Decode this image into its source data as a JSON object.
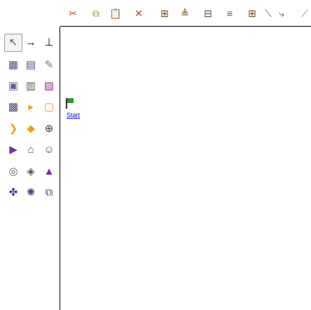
{
  "toolbar": {
    "items": [
      {
        "name": "cut-icon",
        "glyph": "✂",
        "color": "#c24a18"
      },
      {
        "name": "copy-icon",
        "glyph": "⧉",
        "color": "#b08a40"
      },
      {
        "name": "paste-icon",
        "glyph": "📋",
        "color": "#b08a40"
      },
      {
        "name": "delete-icon",
        "glyph": "✕",
        "color": "#c0392b"
      },
      {
        "name": "align-top-icon",
        "glyph": "⊞",
        "color": "#6b4a1a"
      },
      {
        "name": "align-middle-icon",
        "glyph": "≜",
        "color": "#6b4a1a"
      },
      {
        "name": "align-center-icon",
        "glyph": "⊟",
        "color": "#6b4a1a"
      },
      {
        "name": "align-bottom-icon",
        "glyph": "≡",
        "color": "#6b4a1a"
      },
      {
        "name": "distribute-icon",
        "glyph": "⊞",
        "color": "#6b4a1a"
      },
      {
        "name": "straight-line-icon",
        "glyph": "⟍",
        "color": "#2a5aa8"
      },
      {
        "name": "elbow-line-icon",
        "glyph": "⤷",
        "color": "#2a5aa8"
      },
      {
        "name": "curve-line-icon",
        "glyph": "⟋",
        "color": "#3a8fd8"
      }
    ]
  },
  "palette": {
    "items": [
      {
        "name": "pointer-tool-icon",
        "glyph": "↖",
        "color": "#5a5a5a"
      },
      {
        "name": "transition-arrow-icon",
        "glyph": "→",
        "color": "#000000"
      },
      {
        "name": "end-bar-icon",
        "glyph": "⊥",
        "color": "#000000"
      },
      {
        "name": "table-icon",
        "glyph": "▦",
        "color": "#5a4a8a"
      },
      {
        "name": "chart-icon",
        "glyph": "▤",
        "color": "#5a4a8a"
      },
      {
        "name": "edit-icon",
        "glyph": "✎",
        "color": "#7a6aa8"
      },
      {
        "name": "form-icon",
        "glyph": "▣",
        "color": "#6a5a9a"
      },
      {
        "name": "document-icon",
        "glyph": "▥",
        "color": "#5a5a5a"
      },
      {
        "name": "image-icon",
        "glyph": "▨",
        "color": "#8a3a8a"
      },
      {
        "name": "task-icon",
        "glyph": "▩",
        "color": "#4a4a6a"
      },
      {
        "name": "arrow-right-icon",
        "glyph": "▸",
        "color": "#e8a417"
      },
      {
        "name": "note-icon",
        "glyph": "▢",
        "color": "#e8a417"
      },
      {
        "name": "chevron-icon",
        "glyph": "❯",
        "color": "#e8a417"
      },
      {
        "name": "diamond-icon",
        "glyph": "◆",
        "color": "#e8a417"
      },
      {
        "name": "tape-icon",
        "glyph": "⊕",
        "color": "#4a3a2a"
      },
      {
        "name": "play-icon",
        "glyph": "▶",
        "color": "#7a2aa8"
      },
      {
        "name": "house-icon",
        "glyph": "⌂",
        "color": "#5a3a8a"
      },
      {
        "name": "person-icon",
        "glyph": "☺",
        "color": "#4a4a7a"
      },
      {
        "name": "database-icon",
        "glyph": "◎",
        "color": "#5a5a5a"
      },
      {
        "name": "storage-icon",
        "glyph": "◈",
        "color": "#5a5a5a"
      },
      {
        "name": "triangle-icon",
        "glyph": "▲",
        "color": "#7a2aa8"
      },
      {
        "name": "cross-icon",
        "glyph": "✤",
        "color": "#5a3a8a"
      },
      {
        "name": "orbit-icon",
        "glyph": "✺",
        "color": "#5a3a8a"
      },
      {
        "name": "mixer-icon",
        "glyph": "⧉",
        "color": "#5a3a8a"
      }
    ]
  },
  "canvas": {
    "start_label": "Start",
    "start_flag_color": "#2e9a2e"
  }
}
